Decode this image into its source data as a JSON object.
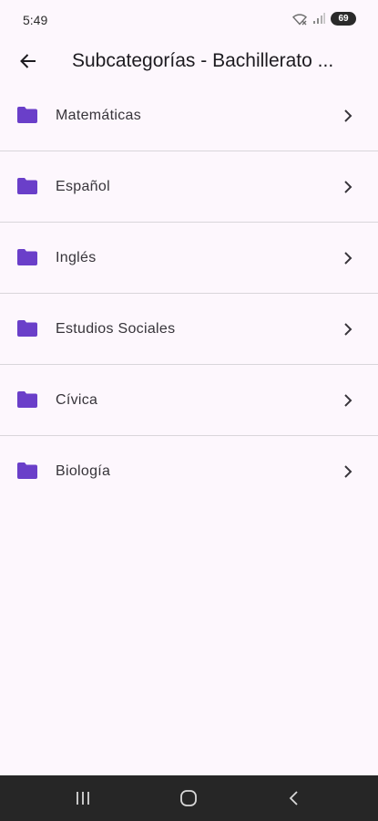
{
  "status_bar": {
    "time": "5:49",
    "battery": "69",
    "icons": [
      "wifi-icon",
      "signal-icon",
      "battery-icon"
    ]
  },
  "app_bar": {
    "title": "Subcategorías - Bachillerato ...",
    "back_icon": "arrow-back-icon"
  },
  "items": [
    {
      "label": "Matemáticas",
      "icon": "folder-icon"
    },
    {
      "label": "Español",
      "icon": "folder-icon"
    },
    {
      "label": "Inglés",
      "icon": "folder-icon"
    },
    {
      "label": "Estudios Sociales",
      "icon": "folder-icon"
    },
    {
      "label": "Cívica",
      "icon": "folder-icon"
    },
    {
      "label": "Biología",
      "icon": "folder-icon"
    }
  ],
  "nav_bar": {
    "icons": [
      "recent-apps-icon",
      "home-icon",
      "back-icon"
    ]
  },
  "colors": {
    "background": "#fdf7fd",
    "folder": "#6a3fc9",
    "divider": "#d9d6db",
    "nav_bar": "#262626"
  }
}
